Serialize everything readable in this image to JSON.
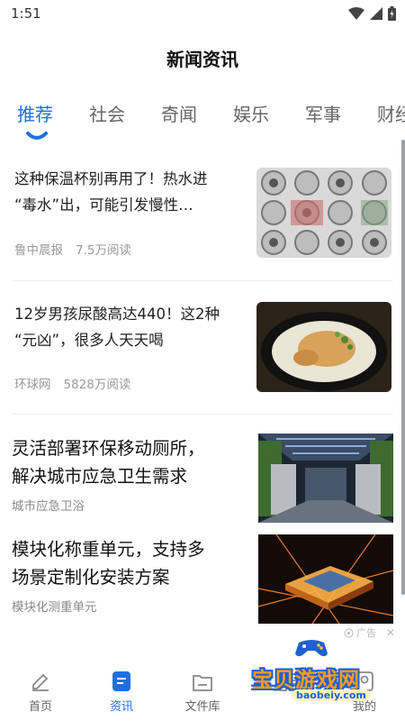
{
  "status": {
    "time": "1:51"
  },
  "header": {
    "title": "新闻资讯"
  },
  "tabs": [
    {
      "label": "推荐",
      "active": true
    },
    {
      "label": "社会",
      "active": false
    },
    {
      "label": "奇闻",
      "active": false
    },
    {
      "label": "娱乐",
      "active": false
    },
    {
      "label": "军事",
      "active": false
    },
    {
      "label": "财经",
      "active": false
    }
  ],
  "articles": [
    {
      "title_line1": "这种保温杯别再用了！热水进",
      "title_line2": "“毒水”出，可能引发慢性…",
      "source": "鲁中晨报",
      "reads": "7.5万阅读"
    },
    {
      "title_line1": "12岁男孩尿酸高达440！这2种",
      "title_line2": "“元凶”，很多人天天喝",
      "source": "环球网",
      "reads": "5828万阅读"
    }
  ],
  "ads": [
    {
      "title_line1": "灵活部署环保移动厕所，",
      "title_line2": "解决城市应急卫生需求",
      "advertiser": "城市应急卫浴"
    },
    {
      "title_line1": "模块化称重单元，支持多",
      "title_line2": "场景定制化安装方案",
      "advertiser": "模块化测重单元"
    }
  ],
  "ad_label": "广告",
  "bottom_nav": [
    {
      "label": "首页",
      "icon": "pencil-icon",
      "active": false
    },
    {
      "label": "资讯",
      "icon": "news-icon",
      "active": true
    },
    {
      "label": "文件库",
      "icon": "folder-icon",
      "active": false
    },
    {
      "label": "",
      "icon": "grid-icon",
      "active": false
    },
    {
      "label": "我的",
      "icon": "profile-icon",
      "active": false
    }
  ],
  "watermark": {
    "text": "宝贝游戏网",
    "url": "baobeiy.com"
  },
  "colors": {
    "accent": "#1f6fe0",
    "text": "#222222",
    "meta": "#999999",
    "watermark": "#ff9c1a"
  }
}
